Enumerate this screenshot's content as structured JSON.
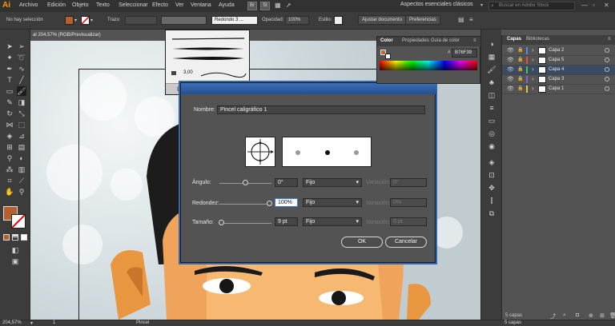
{
  "app": {
    "logo": "Ai",
    "menu": [
      "Archivo",
      "Edición",
      "Objeto",
      "Texto",
      "Seleccionar",
      "Efecto",
      "Ver",
      "Ventana",
      "Ayuda"
    ],
    "bridge_buttons": [
      "Br",
      "St"
    ],
    "workspace": "Aspectos esenciales clásicos",
    "search_placeholder": "Buscar en Adobe Stock"
  },
  "control_bar": {
    "selection": "No hay selección",
    "fill_color": "#b5612f",
    "stroke_label": "Trazo",
    "brush": "Redondo 3 ...",
    "opacity_label": "Opacidad:",
    "opacity_value": "100%",
    "style_label": "Estilo:",
    "doc_setup": "Ajustar documento",
    "prefs": "Preferencias"
  },
  "document_tab": "al 204,57% (RGB/Previsualizar)",
  "brush_popup": {
    "size_label": "3,00"
  },
  "toolbar": {
    "fill_color": "#b5612f",
    "icons": [
      "selection-arrow-icon",
      "direct-selection-icon",
      "magic-wand-icon",
      "lasso-icon",
      "pen-icon",
      "curvature-icon",
      "type-icon",
      "line-segment-icon",
      "rectangle-icon",
      "paintbrush-icon",
      "pencil-icon",
      "eraser-icon",
      "rotate-icon",
      "scale-icon",
      "width-icon",
      "free-transform-icon",
      "shape-builder-icon",
      "perspective-grid-icon",
      "mesh-icon",
      "gradient-icon",
      "eyedropper-icon",
      "blend-icon",
      "symbol-sprayer-icon",
      "column-graph-icon",
      "artboard-icon",
      "slice-icon",
      "hand-icon",
      "zoom-icon"
    ]
  },
  "dialog": {
    "name_label": "Nombre:",
    "name_value": "Pincel caligráfico 1",
    "rows": [
      {
        "label": "Ángulo:",
        "value": "0°",
        "mode": "Fijo",
        "var_label": "Variación:",
        "var_value": "0°",
        "slider": 0.5
      },
      {
        "label": "Redondez:",
        "value": "100%",
        "mode": "Fijo",
        "var_label": "Variación:",
        "var_value": "0%",
        "slider": 1.0
      },
      {
        "label": "Tamaño:",
        "value": "9 pt",
        "mode": "Fijo",
        "var_label": "Variación:",
        "var_value": "0 pt",
        "slider": 0.07
      }
    ],
    "ok": "OK",
    "cancel": "Cancelar"
  },
  "color_panel": {
    "tabs": [
      "Color",
      "Propiedades",
      "Guía de color"
    ],
    "hex_label": "#",
    "hex": "B76F39"
  },
  "layers_panel": {
    "tabs": [
      "Capas",
      "Bibliotecas"
    ],
    "layers": [
      {
        "name": "Capa 2",
        "color": "#4f8be0",
        "active": false
      },
      {
        "name": "Capa 5",
        "color": "#e24f4f",
        "active": false
      },
      {
        "name": "Capa 4",
        "color": "#4fc04f",
        "active": true
      },
      {
        "name": "Capa 3",
        "color": "#8c5ae0",
        "active": false
      },
      {
        "name": "Capa 1",
        "color": "#e0c84f",
        "active": false
      }
    ],
    "count": "5 capas"
  },
  "status_bar": {
    "zoom": "204,57%",
    "page": "1",
    "tool": "Pincel"
  }
}
